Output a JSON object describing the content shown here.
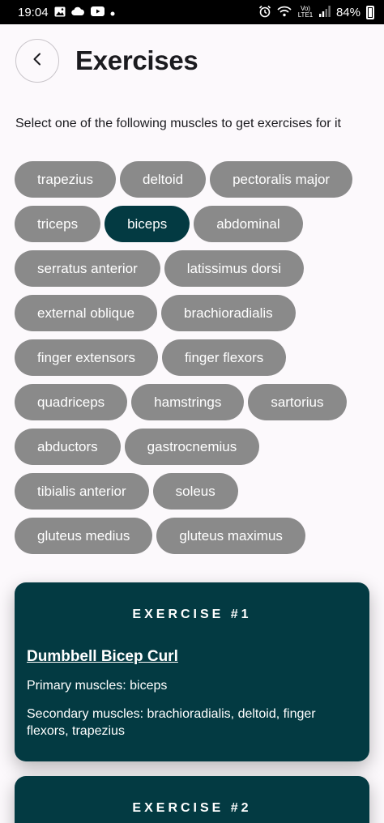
{
  "status_bar": {
    "time": "19:04",
    "battery": "84%",
    "left_icons": [
      "gallery-icon",
      "cloud-icon",
      "youtube-icon",
      "dot-icon"
    ],
    "right_icons": [
      "alarm-icon",
      "wifi-icon",
      "volte-icon",
      "signal-icon",
      "battery-icon"
    ],
    "volte_text": "Vo) LTE1"
  },
  "header": {
    "back_icon": "chevron-left-icon",
    "title": "Exercises"
  },
  "instruction": "Select one of the following muscles to get exercises for it",
  "muscles": [
    "trapezius",
    "deltoid",
    "pectoralis major",
    "triceps",
    "biceps",
    "abdominal",
    "serratus anterior",
    "latissimus dorsi",
    "external oblique",
    "brachioradialis",
    "finger extensors",
    "finger flexors",
    "quadriceps",
    "hamstrings",
    "sartorius",
    "abductors",
    "gastrocnemius",
    "tibialis anterior",
    "soleus",
    "gluteus medius",
    "gluteus maximus"
  ],
  "selected_muscle": "biceps",
  "colors": {
    "chip": "#8a8a8a",
    "chip_selected": "#033a42",
    "card": "#033a42",
    "background": "#fcf9fc"
  },
  "exercises": [
    {
      "heading": "EXERCISE #1",
      "name": "Dumbbell Bicep Curl",
      "primary": "Primary muscles: biceps",
      "secondary": "Secondary muscles: brachioradialis, deltoid, finger flexors, trapezius"
    },
    {
      "heading": "EXERCISE #2"
    }
  ]
}
